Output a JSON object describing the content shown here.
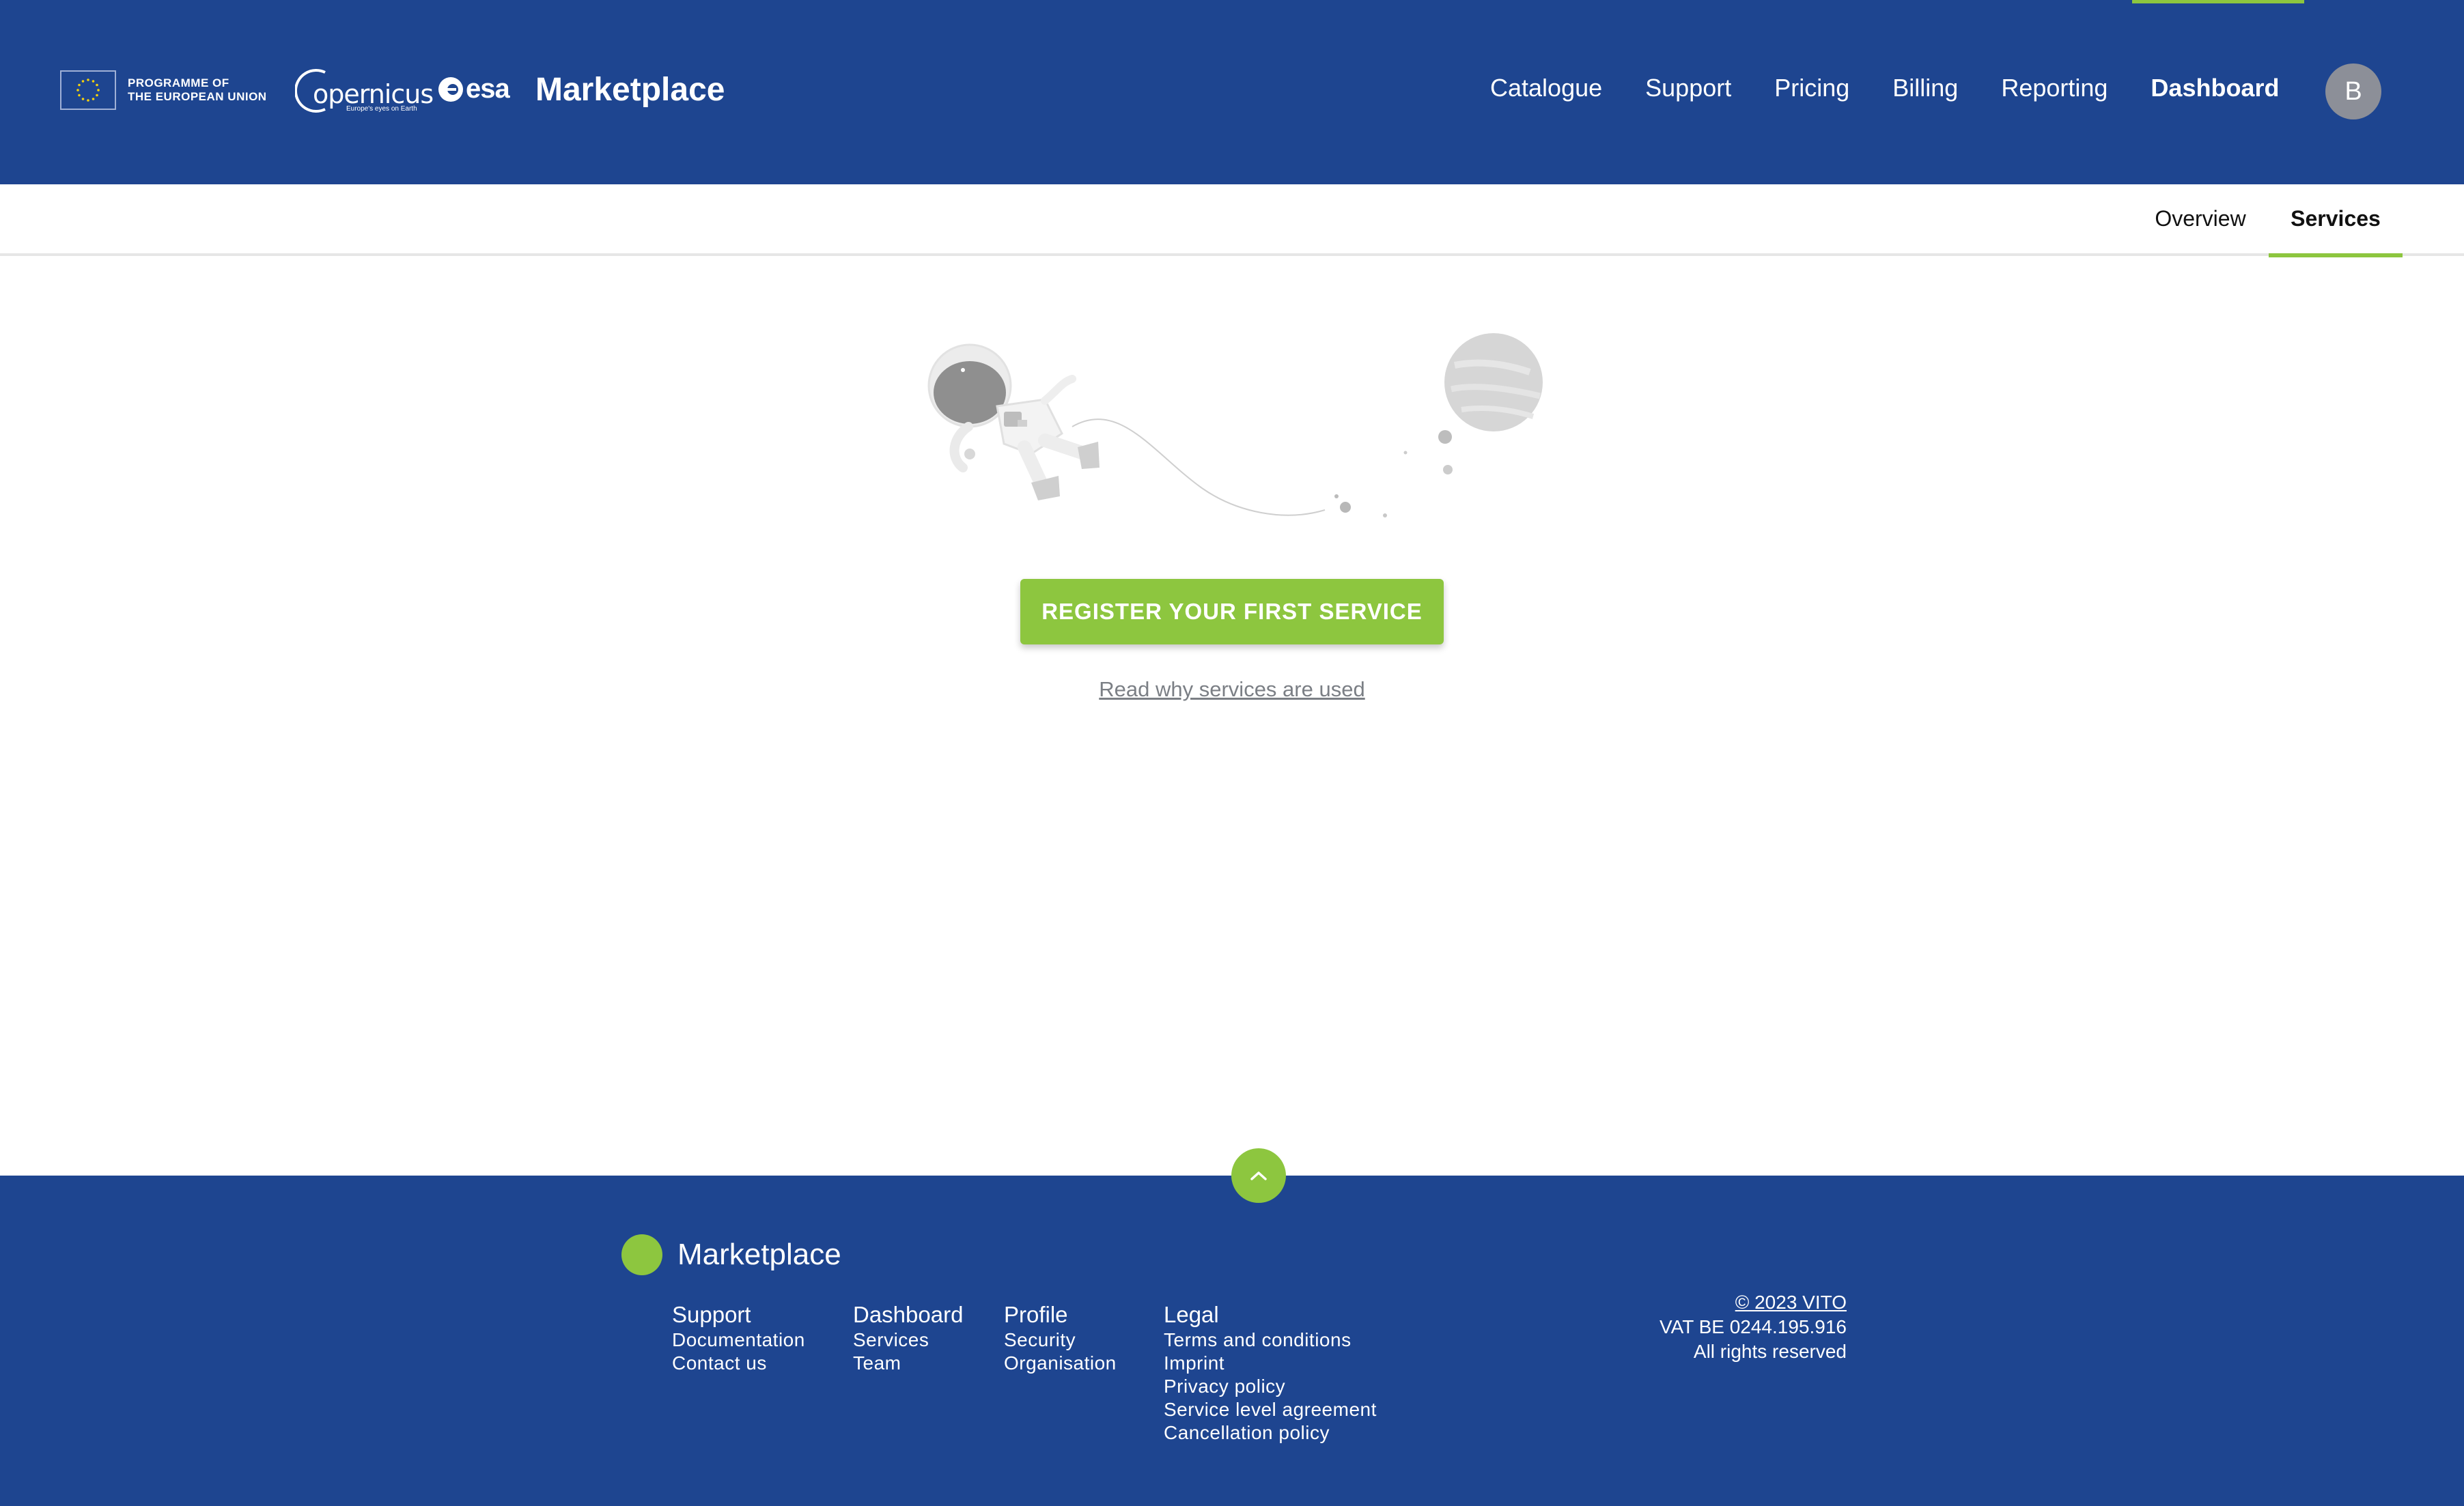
{
  "header": {
    "eu_programme_line1": "PROGRAMME OF",
    "eu_programme_line2": "THE EUROPEAN UNION",
    "copernicus_word": "opernicus",
    "copernicus_tagline": "Europe's eyes on Earth",
    "esa_word": "esa",
    "brand_title": "Marketplace",
    "nav": [
      "Catalogue",
      "Support",
      "Pricing",
      "Billing",
      "Reporting",
      "Dashboard"
    ],
    "active_nav": "Dashboard",
    "avatar_initial": "B"
  },
  "subnav": {
    "tabs": [
      "Overview",
      "Services"
    ],
    "active": "Services"
  },
  "empty_state": {
    "illustration": "astronaut-floating-to-planet",
    "button_label": "REGISTER YOUR FIRST SERVICE",
    "link_text": "Read why services are used"
  },
  "footer": {
    "brand": "Marketplace",
    "columns": [
      {
        "heading": "Support",
        "links": [
          "Documentation",
          "Contact us"
        ]
      },
      {
        "heading": "Dashboard",
        "links": [
          "Services",
          "Team"
        ]
      },
      {
        "heading": "Profile",
        "links": [
          "Security",
          "Organisation"
        ]
      },
      {
        "heading": "Legal",
        "links": [
          "Terms and conditions",
          "Imprint",
          "Privacy policy",
          "Service level agreement",
          "Cancellation policy"
        ]
      }
    ],
    "copyright": "© 2023 VITO",
    "vat": "VAT BE 0244.195.916",
    "rights": "All rights reserved"
  },
  "colors": {
    "header_bg": "#1e4590",
    "accent": "#8dc63f",
    "avatar_bg": "#8c8f98",
    "link_grey": "#7b7f85"
  },
  "icons": {
    "scroll_to_top": "chevron-up-icon",
    "footer_brand": "green-dot-icon"
  }
}
